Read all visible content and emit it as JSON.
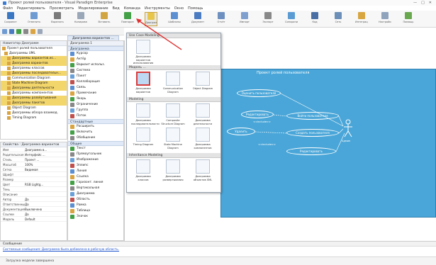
{
  "window": {
    "title": "Проект ролей пользователя - Visual Paradigm Enterprise",
    "controls": [
      "—",
      "□",
      "✕"
    ]
  },
  "menubar": [
    "Файл",
    "Редактировать",
    "Просмотреть",
    "Моделирование",
    "Вид",
    "Команда",
    "Инструменты",
    "Окно",
    "Помощь"
  ],
  "toolbar": {
    "buttons": [
      {
        "label": "Сохранить",
        "color": "#3b78c4"
      },
      {
        "label": "Отменить",
        "color": "#6f9bd3"
      },
      {
        "label": "Вырезать",
        "color": "#7a7a7a"
      },
      {
        "label": "Копировать",
        "color": "#9aa7b8"
      },
      {
        "label": "Вставить",
        "color": "#d2a543"
      },
      {
        "label": "Повторить",
        "color": "#43a047"
      },
      {
        "label": "Диаграмма",
        "color": "#e7c64a",
        "selected": true
      },
      {
        "label": "Шаблоны",
        "color": "#5b8fd1"
      },
      {
        "label": "Документ",
        "color": "#4b7cc2"
      },
      {
        "label": "Отчёт",
        "color": "#6d90c0"
      },
      {
        "label": "Импорт",
        "color": "#7f9fcf"
      },
      {
        "label": "Экспорт",
        "color": "#888"
      },
      {
        "label": "Синхронизация",
        "color": "#5a9bd4"
      },
      {
        "label": "Код",
        "color": "#4a6fa5"
      },
      {
        "label": "Сеть",
        "color": "#6b8fb8"
      },
      {
        "label": "Интеграция",
        "color": "#d8a640"
      },
      {
        "label": "Настройки",
        "color": "#8fa3bd"
      },
      {
        "label": "Помощь",
        "color": "#6aa84f"
      }
    ]
  },
  "tabs": [
    "Диаграмма вариантов ..."
  ],
  "diagram_nav": {
    "title": "Навигатор Диаграмм",
    "items": [
      {
        "label": "Проект ролей пользователя",
        "highlight": false
      },
      {
        "label": "Диаграммы UML",
        "highlight": false
      },
      {
        "label": "Диаграммы вариантов ис...",
        "highlight": true
      },
      {
        "label": "Диаграмма вариантов",
        "highlight": true
      },
      {
        "label": "Диаграммы классов",
        "highlight": false
      },
      {
        "label": "Диаграммы последовательн...",
        "highlight": true
      },
      {
        "label": "Communication Diagram",
        "highlight": false
      },
      {
        "label": "State Machine Diagram",
        "highlight": true
      },
      {
        "label": "Диаграммы деятельности",
        "highlight": true
      },
      {
        "label": "Диаграммы компонентов",
        "highlight": false
      },
      {
        "label": "Диаграммы развёртывания",
        "highlight": true
      },
      {
        "label": "Диаграммы пакетов",
        "highlight": true
      },
      {
        "label": "Object Diagram",
        "highlight": false
      },
      {
        "label": "Диаграммы обзора взаимод.",
        "highlight": false
      },
      {
        "label": "Timing Diagram",
        "highlight": false
      }
    ]
  },
  "properties": {
    "title": "Свойства : Диаграмма вариантов",
    "rows": [
      {
        "k": "Имя",
        "v": "Диаграмма в..."
      },
      {
        "k": "Родительская",
        "v": "Интерфейс ..."
      },
      {
        "k": "Стиль",
        "v": "Проект ..."
      },
      {
        "k": "Масштаб",
        "v": "100%"
      },
      {
        "k": "Сетка",
        "v": "Видимая"
      },
      {
        "k": "Шрифт",
        "v": ""
      },
      {
        "k": "Размер",
        "v": ""
      },
      {
        "k": "Цвет",
        "v": "RGB Lightg..."
      },
      {
        "k": "Тень",
        "v": ""
      },
      {
        "k": "Описание",
        "v": ""
      },
      {
        "k": "Автор",
        "v": "Да"
      },
      {
        "k": "Ответственный",
        "v": "Да"
      },
      {
        "k": "Документация",
        "v": "Выключено"
      },
      {
        "k": "Ссылки",
        "v": "Да"
      },
      {
        "k": "Модель",
        "v": "Default"
      }
    ]
  },
  "palette": {
    "title": "Диаграмма 1",
    "sections": [
      {
        "head": "Диаграмма",
        "items": [
          "Курсор",
          "Актёр",
          "Вариант использ.",
          "Система",
          "Пакет",
          "Коллаборация",
          "Связь",
          "Примечание",
          "Якорь",
          "Ограничение",
          "Группа",
          "Поток"
        ]
      },
      {
        "head": "Стандартные",
        "items": [
          "Расширить",
          "Включить",
          "Обобщение"
        ]
      },
      {
        "head": "Общие",
        "items": [
          "Текст",
          "Прямоугольник",
          "Изображение",
          "Эллипс",
          "Линия",
          "Ссылка",
          "Горизонт. линия",
          "Вертикальная",
          "Диаграмма",
          "Область",
          "Рамка",
          "Таблица",
          "Значок"
        ]
      }
    ]
  },
  "popup": {
    "sections": [
      {
        "head": "Use Case Modeling",
        "cells": [
          {
            "label": "Диаграмма вариантов использования"
          }
        ]
      },
      {
        "head": "Модель ...",
        "cells": [
          {
            "label": "Диаграмма вариантов",
            "selected": true
          },
          {
            "label": "Communication Diagram"
          },
          {
            "label": "Object Diagram"
          }
        ]
      },
      {
        "head": "Modeling",
        "cells": [
          {
            "label": "Диаграмма последовательности"
          },
          {
            "label": "Composite Structure Diagram"
          },
          {
            "label": "Диаграмма деятельности"
          },
          {
            "label": "Timing Diagram"
          },
          {
            "label": "State Machine Diagram"
          },
          {
            "label": "Диаграмма компонентов"
          }
        ]
      },
      {
        "head": "Inheritance Modeling",
        "cells": [
          {
            "label": "Диаграмма классов"
          },
          {
            "label": "Диаграмма развертывания"
          },
          {
            "label": "Диаграмма объектов SML"
          }
        ]
      }
    ]
  },
  "diagram": {
    "title": "Проект ролей пользователя",
    "usecases": [
      "Оценить пользователя",
      "Редактировать",
      "Удалить",
      "Войти пользователя",
      "Создать пользователя",
      "Редактировать"
    ],
    "notes": [
      "<<include>>",
      "<<include>>"
    ],
    "actor_label": "Админ"
  },
  "output": {
    "title": "Сообщение",
    "link": "Системные сообщения: Диаграмма была добавлена в рабочую область."
  },
  "status": {
    "text": "Загрузка модели завершена"
  }
}
